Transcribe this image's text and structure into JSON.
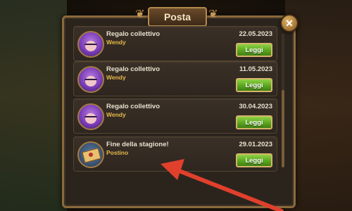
{
  "window": {
    "title": "Posta",
    "close_icon": "close-icon"
  },
  "mails": [
    {
      "title": "Regalo collettivo",
      "sender": "Wendy",
      "date": "22.05.2023",
      "button": "Leggi",
      "icon": "wendy-avatar"
    },
    {
      "title": "Regalo collettivo",
      "sender": "Wendy",
      "date": "11.05.2023",
      "button": "Leggi",
      "icon": "wendy-avatar"
    },
    {
      "title": "Regalo collettivo",
      "sender": "Wendy",
      "date": "30.04.2023",
      "button": "Leggi",
      "icon": "wendy-avatar"
    },
    {
      "title": "Fine della stagione!",
      "sender": "Postino",
      "date": "29.01.2023",
      "button": "Leggi",
      "icon": "letter-icon"
    }
  ],
  "colors": {
    "accent_green": "#5aa61f",
    "gold": "#e5b94a",
    "arrow_red": "#e0402c"
  }
}
